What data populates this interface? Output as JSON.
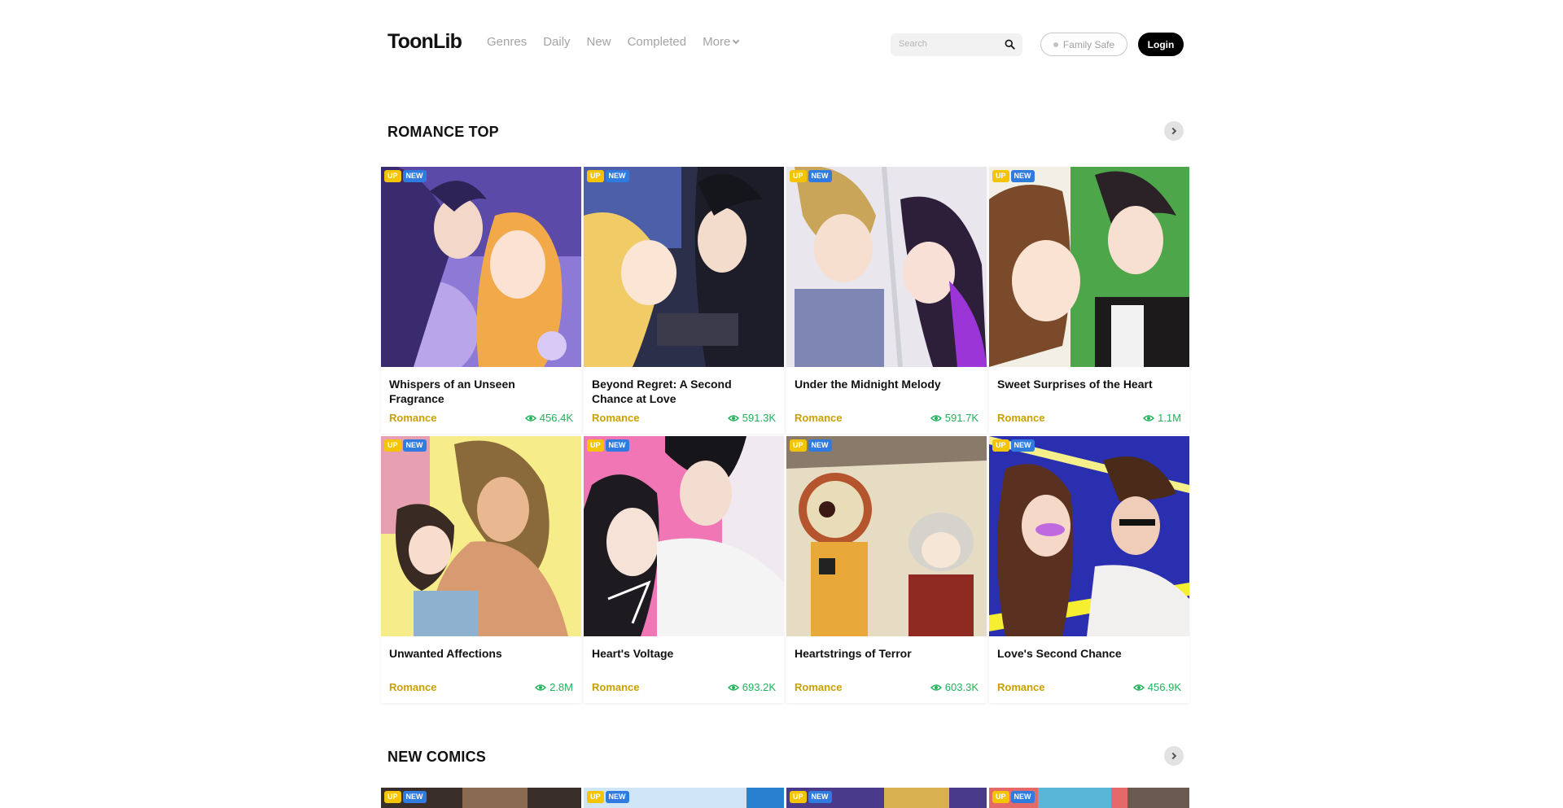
{
  "header": {
    "logo": "ToonLib",
    "nav": [
      "Genres",
      "Daily",
      "New",
      "Completed"
    ],
    "more_label": "More",
    "search_placeholder": "Search",
    "family_safe": "Family Safe",
    "login": "Login"
  },
  "badges": {
    "up": "UP",
    "new": "NEW"
  },
  "sections": [
    {
      "title": "ROMANCE TOP",
      "cards": [
        {
          "title": "Whispers of an Unseen Fragrance",
          "genre": "Romance",
          "views": "456.4K"
        },
        {
          "title": "Beyond Regret: A Second Chance at Love",
          "genre": "Romance",
          "views": "591.3K"
        },
        {
          "title": "Under the Midnight Melody",
          "genre": "Romance",
          "views": "591.7K"
        },
        {
          "title": "Sweet Surprises of the Heart",
          "genre": "Romance",
          "views": "1.1M"
        },
        {
          "title": "Unwanted Affections",
          "genre": "Romance",
          "views": "2.8M"
        },
        {
          "title": "Heart's Voltage",
          "genre": "Romance",
          "views": "693.2K"
        },
        {
          "title": "Heartstrings of Terror",
          "genre": "Romance",
          "views": "603.3K"
        },
        {
          "title": "Love's Second Chance",
          "genre": "Romance",
          "views": "456.9K"
        }
      ]
    },
    {
      "title": "NEW COMICS"
    }
  ],
  "colors": {
    "up_badge": "#f4c400",
    "new_badge": "#2f7be0",
    "genre": "#c9a000",
    "views": "#20b15a"
  }
}
